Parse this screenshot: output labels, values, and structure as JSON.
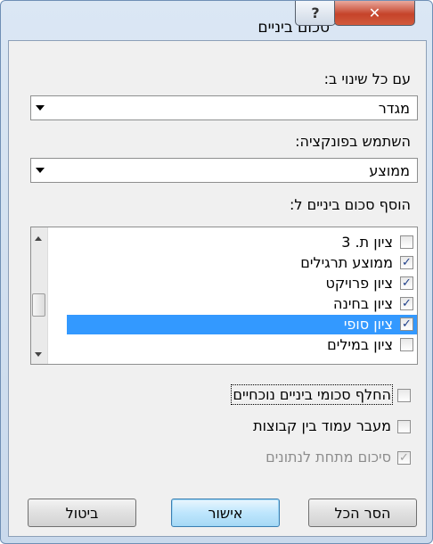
{
  "window": {
    "title": "סכום ביניים",
    "help_label": "?",
    "close_label": "✕"
  },
  "labels": {
    "at_each_change": "עם כל שינוי ב:",
    "use_function": "השתמש בפונקציה:",
    "add_subtotal_to": "הוסף סכום ביניים ל:"
  },
  "combos": {
    "at_each_change_value": "מגדר",
    "function_value": "ממוצע"
  },
  "list_items": [
    {
      "label": "ציון ת. 3",
      "checked": false
    },
    {
      "label": "ממוצע  תרגילים",
      "checked": true
    },
    {
      "label": "ציון פרויקט",
      "checked": true
    },
    {
      "label": "ציון בחינה",
      "checked": true
    },
    {
      "label": "ציון סופי",
      "checked": true,
      "selected": true
    },
    {
      "label": "ציון במילים",
      "checked": false
    }
  ],
  "options": {
    "replace_current": "החלף סכומי ביניים נוכחיים",
    "page_break": "מעבר עמוד בין קבוצות",
    "summary_below": "סיכום מתחת לנתונים"
  },
  "buttons": {
    "remove_all": "הסר הכל",
    "ok": "אישור",
    "cancel": "ביטול"
  },
  "icons": {
    "check": "✓",
    "check_mark_icon": "check-mark-icon"
  }
}
